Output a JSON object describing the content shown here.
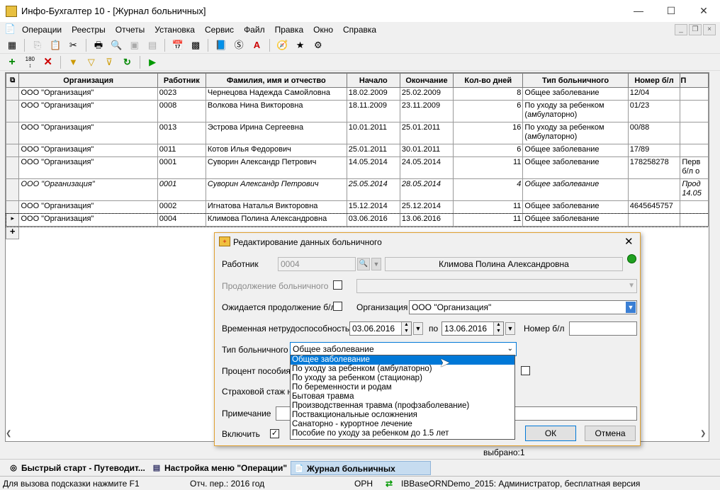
{
  "window": {
    "title": "Инфо-Бухгалтер 10 - [Журнал больничных]"
  },
  "menu": [
    "Операции",
    "Реестры",
    "Отчеты",
    "Установка",
    "Сервис",
    "Файл",
    "Правка",
    "Окно",
    "Справка"
  ],
  "grid": {
    "columns": [
      "Организация",
      "Работник",
      "Фамилия, имя и отчество",
      "Начало",
      "Окончание",
      "Кол-во дней",
      "Тип больничного",
      "Номер б/л",
      "П"
    ],
    "rows": [
      {
        "org": "ООО \"Организация\"",
        "emp": "0023",
        "fio": "Чернецова Надежда Самойловна",
        "start": "18.02.2009",
        "end": "25.02.2009",
        "days": "8",
        "type1": "Общее заболевание",
        "type2": "",
        "num": "12/04",
        "p1": "",
        "p2": "",
        "italic": false,
        "current": false
      },
      {
        "org": "ООО \"Организация\"",
        "emp": "0008",
        "fio": "Волкова Нина Викторовна",
        "start": "18.11.2009",
        "end": "23.11.2009",
        "days": "6",
        "type1": "По уходу за ребенком",
        "type2": "(амбулаторно)",
        "num": "01/23",
        "p1": "",
        "p2": "",
        "italic": false,
        "current": false
      },
      {
        "org": "ООО \"Организация\"",
        "emp": "0013",
        "fio": "Эстрова Ирина Сергеевна",
        "start": "10.01.2011",
        "end": "25.01.2011",
        "days": "16",
        "type1": "По уходу за ребенком",
        "type2": "(амбулаторно)",
        "num": "00/88",
        "p1": "",
        "p2": "",
        "italic": false,
        "current": false
      },
      {
        "org": "ООО \"Организация\"",
        "emp": "0011",
        "fio": "Котов Илья Федорович",
        "start": "25.01.2011",
        "end": "30.01.2011",
        "days": "6",
        "type1": "Общее заболевание",
        "type2": "",
        "num": "17/89",
        "p1": "",
        "p2": "",
        "italic": false,
        "current": false
      },
      {
        "org": "ООО \"Организация\"",
        "emp": "0001",
        "fio": "Суворин Александр Петрович",
        "start": "14.05.2014",
        "end": "24.05.2014",
        "days": "11",
        "type1": "Общее заболевание",
        "type2": "",
        "num": "178258278",
        "p1": "Перв",
        "p2": "б/л  о",
        "italic": false,
        "current": false
      },
      {
        "org": "ООО \"Организация\"",
        "emp": "0001",
        "fio": "Суворин Александр Петрович",
        "start": "25.05.2014",
        "end": "28.05.2014",
        "days": "4",
        "type1": "Общее заболевание",
        "type2": "",
        "num": "",
        "p1": "Прод",
        "p2": "14.05",
        "italic": true,
        "current": false
      },
      {
        "org": "ООО \"Организация\"",
        "emp": "0002",
        "fio": "Игнатова Наталья Викторовна",
        "start": "15.12.2014",
        "end": "25.12.2014",
        "days": "11",
        "type1": "Общее заболевание",
        "type2": "",
        "num": "4645645757",
        "p1": "",
        "p2": "",
        "italic": false,
        "current": false
      },
      {
        "org": "ООО \"Организация\"",
        "emp": "0004",
        "fio": "Климова Полина Александровна",
        "start": "03.06.2016",
        "end": "13.06.2016",
        "days": "11",
        "type1": "Общее заболевание",
        "type2": "",
        "num": "",
        "p1": "",
        "p2": "",
        "italic": false,
        "current": true
      }
    ],
    "add_row_glyph": "+",
    "current_row_glyph": "▸"
  },
  "dialog": {
    "title": "Редактирование данных больничного",
    "employee_label": "Работник",
    "employee_code": "0004",
    "employee_name": "Климова Полина Александровна",
    "continuation_label": "Продолжение больничного",
    "expect_continuation_label": "Ожидается продолжение б/л",
    "organization_label": "Организация",
    "organization_value": "ООО \"Организация\"",
    "disability_label": "Временная нетрудоспособность с",
    "date_from": "03.06.2016",
    "date_to_label": "по",
    "date_to": "13.06.2016",
    "sick_number_label": "Номер б/л",
    "sick_number_value": "",
    "type_label": "Тип больничного",
    "type_value": "Общее заболевание",
    "percent_label": "Процент пособия",
    "stazh_label": "Страховой стаж на",
    "note_label": "Примечание",
    "include_label": "Включить",
    "include_checked": "✓",
    "ok_label": "ОК",
    "cancel_label": "Отмена",
    "status_color": "#20a020"
  },
  "dropdown_options": [
    "Общее заболевание",
    "По уходу за ребенком (амбулаторно)",
    "По уходу за ребенком (стационар)",
    "По беременности и родам",
    "Бытовая травма",
    "Производственная травма (профзаболевание)",
    "Поствакциональные осложнения",
    "Санаторно - курортное лечение",
    "Пособие по уходу за ребенком до 1.5 лет"
  ],
  "selected_text": "выбрано:1",
  "tabs": [
    "Быстрый старт - Путеводит...",
    "Настройка меню \"Операции\"",
    "Журнал больничных"
  ],
  "status": {
    "hint": "Для вызова подсказки нажмите F1",
    "period": "Отч. пер.: 2016 год",
    "mode": "ОРН",
    "db": "IBBaseORNDemo_2015: Администратор, бесплатная версия"
  },
  "window_controls": {
    "minimize": "—",
    "maximize": "☐",
    "close": "✕"
  }
}
